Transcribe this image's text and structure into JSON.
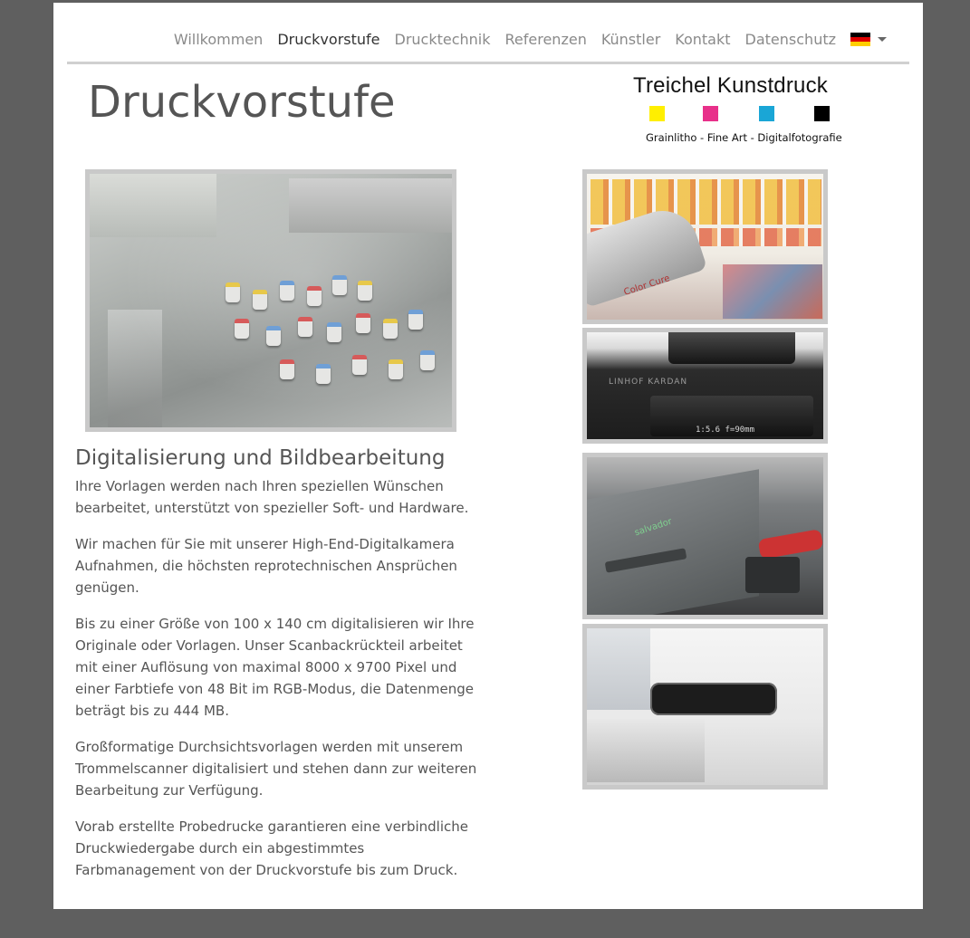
{
  "nav": {
    "items": [
      {
        "label": "Willkommen",
        "active": false
      },
      {
        "label": "Druckvorstufe",
        "active": true
      },
      {
        "label": "Drucktechnik",
        "active": false
      },
      {
        "label": "Referenzen",
        "active": false
      },
      {
        "label": "Künstler",
        "active": false
      },
      {
        "label": "Kontakt",
        "active": false
      },
      {
        "label": "Datenschutz",
        "active": false
      }
    ],
    "language_flag": "german-flag-icon"
  },
  "page": {
    "title": "Druckvorstufe"
  },
  "logo": {
    "name": "Treichel Kunstdruck",
    "tagline": "Grainlitho - Fine Art - Digitalfotografie",
    "swatch_colors": [
      "#ffef00",
      "#e8308a",
      "#1aa6d6",
      "#000000"
    ]
  },
  "section": {
    "heading": "Digitalisierung und Bildbearbeitung",
    "paragraphs": [
      "Ihre Vorlagen werden nach Ihren speziellen Wünschen bearbeitet, unterstützt von spezieller Soft- und Hardware.",
      "Wir machen für Sie mit unserer High-End-Digitalkamera Aufnahmen, die höchsten reprotechnischen Ansprüchen genügen.",
      "Bis zu einer Größe von 100 x 140 cm digitalisieren wir Ihre Originale oder Vorlagen. Unser Scanbackrückteil arbeitet mit einer Auflösung von maximal 8000 x 9700 Pixel und einer Farbtiefe von 48 Bit im RGB-Modus, die Datenmenge beträgt bis zu 444 MB.",
      "Großformatige Durchsichtsvorlagen werden mit unserem Trommelscanner digitalisiert und stehen dann zur weiteren Bearbeitung zur Verfügung.",
      "Vorab erstellte Probedrucke garantieren eine verbindliche Druckwiedergabe durch ein abgestimmtes Farbmanagement von der Druckvorstufe bis zum Druck."
    ]
  },
  "photo_labels": {
    "colorimeter": "Color Cure",
    "lens_brand": "LINHOF KARDAN",
    "lens_spec": "1:5.6  f=90mm",
    "scanback": "salvador"
  },
  "colors": {
    "background": "#5f5f5f",
    "text": "#555555",
    "nav_inactive": "#8a8a8a",
    "nav_active": "#333333",
    "rule": "#d0d0d0"
  }
}
